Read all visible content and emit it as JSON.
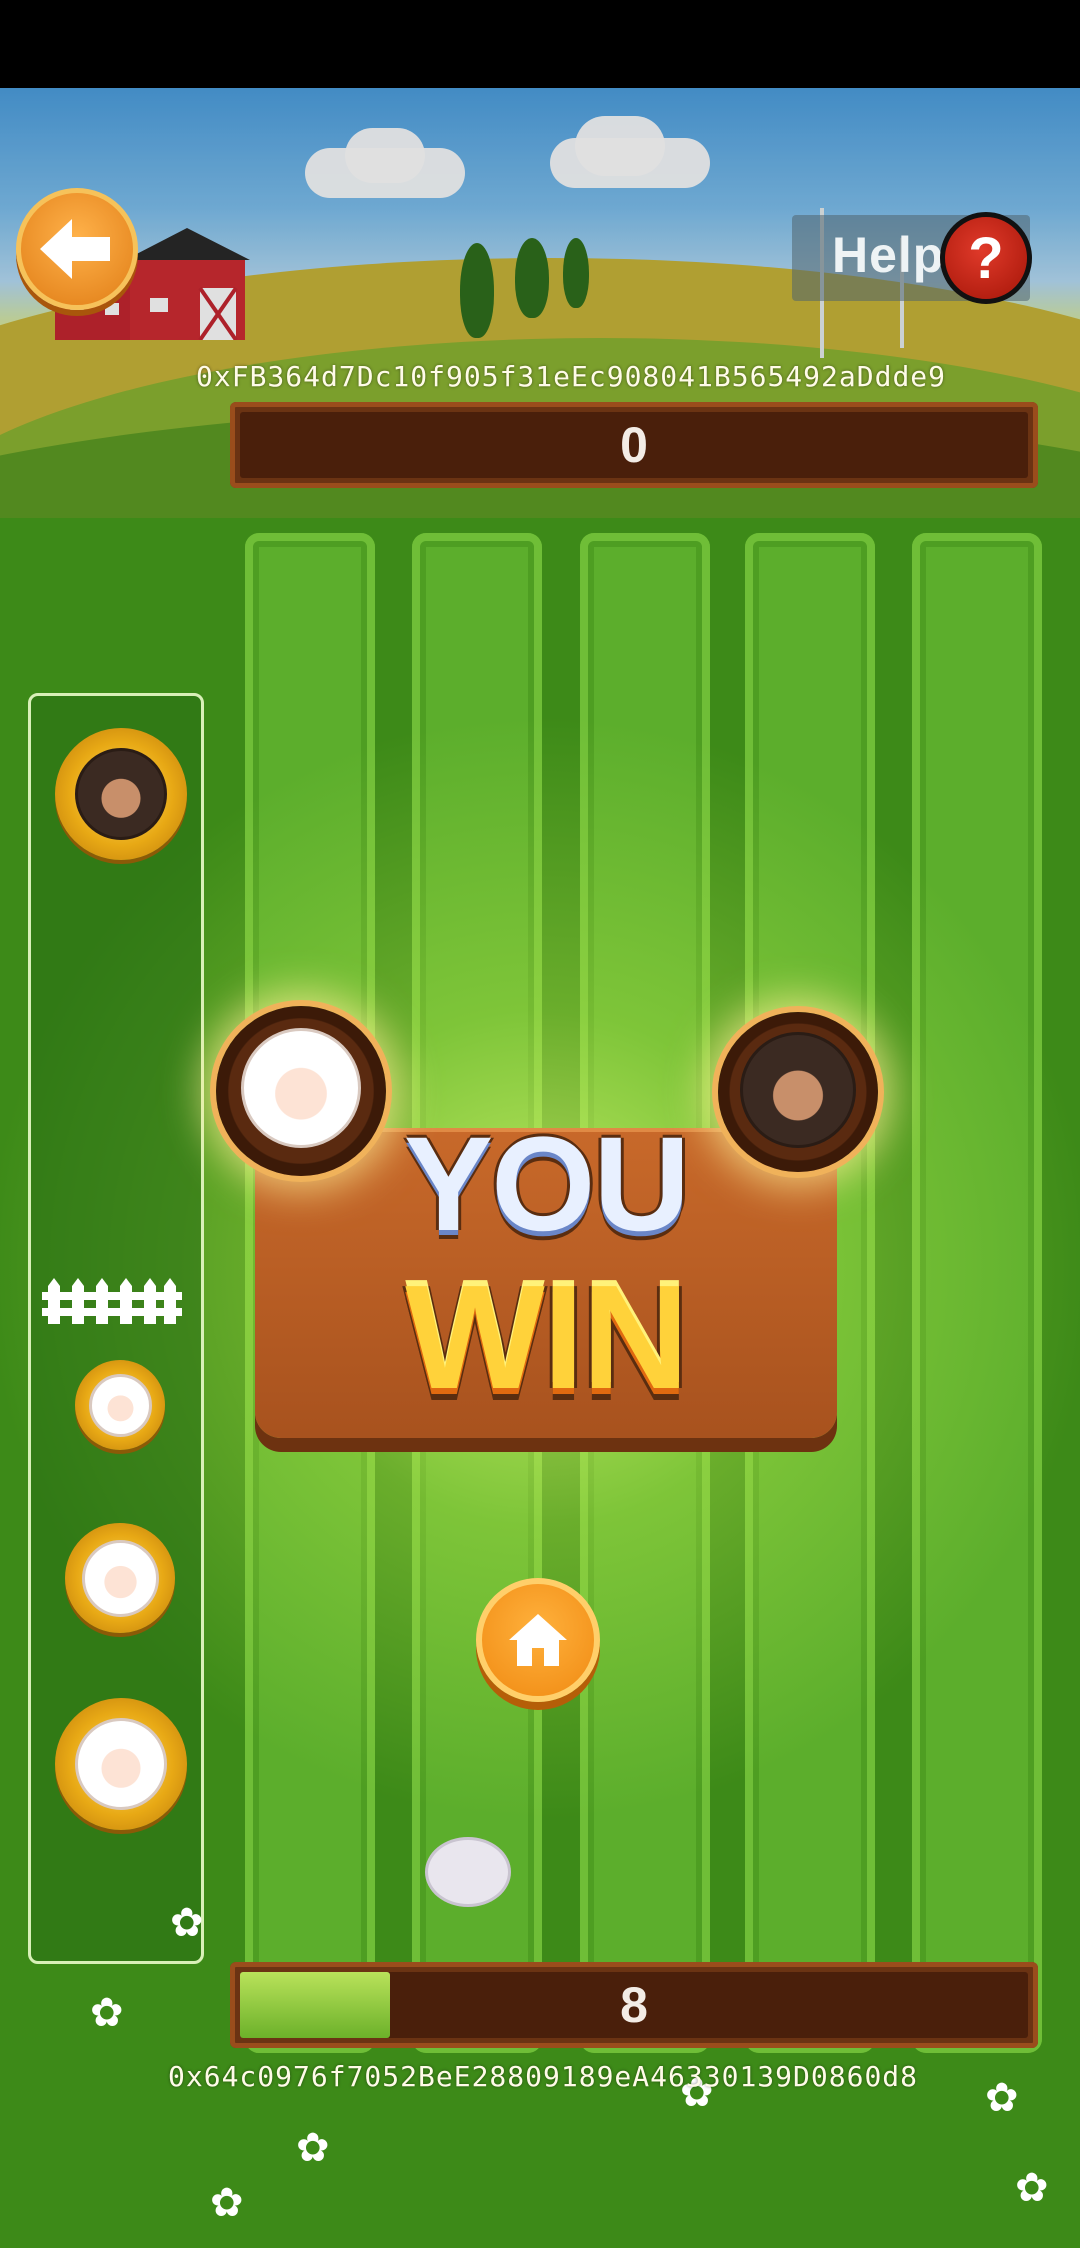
{
  "header": {
    "help_label": "Help",
    "help_icon": "question-mark-icon",
    "back_icon": "arrow-left-icon",
    "player_address": "0xFB364d7Dc10f905f31eEc908041B565492aDdde9",
    "top_score": "0"
  },
  "footer": {
    "bottom_score": "8",
    "bottom_progress": 0.19,
    "opponent_address": "0x64c0976f7052BeE28809189eA46330139D0860d8"
  },
  "overlay": {
    "line1": "YOU",
    "line2": "WIN",
    "home_icon": "home-icon"
  },
  "colors": {
    "board": "#a8521e",
    "win_text": "#ffd23a",
    "button": "#f08a12",
    "field": "#3d8a18"
  }
}
